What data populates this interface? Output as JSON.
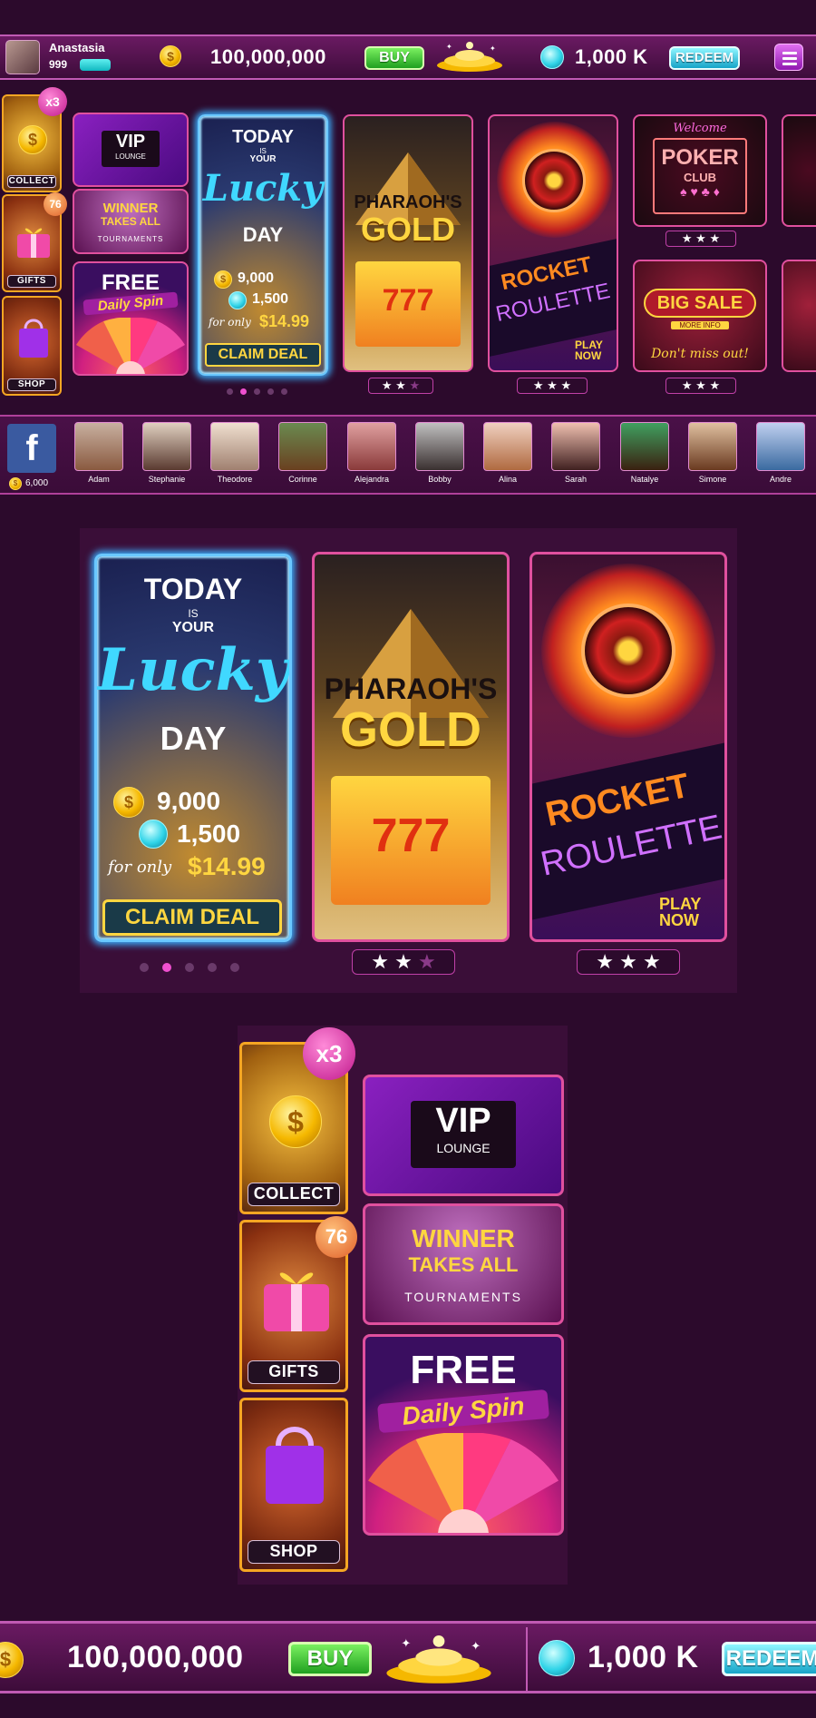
{
  "topbar": {
    "username": "Anastasia",
    "level": "999",
    "coins": "100,000,000",
    "buy_label": "BUY",
    "gems": "1,000 K",
    "redeem_label": "REDEEM"
  },
  "side_tiles": {
    "collect": {
      "label": "COLLECT",
      "badge": "x3"
    },
    "gifts": {
      "label": "GIFTS",
      "badge": "76"
    },
    "shop": {
      "label": "SHOP"
    }
  },
  "promo_tiles": {
    "vip": {
      "line1": "VIP",
      "line2": "LOUNGE"
    },
    "winner": {
      "line1": "WINNER",
      "line2": "TAKES ALL",
      "line3": "TOURNAMENTS"
    },
    "free_spin": {
      "line1": "FREE",
      "line2": "Daily Spin"
    }
  },
  "lucky_deal": {
    "line1": "TODAY",
    "line2": "IS",
    "line3": "YOUR",
    "line4": "Lucky",
    "line5": "DAY",
    "coins": "9,000",
    "gems": "1,500",
    "price_prefix": "for only",
    "price": "$14.99",
    "button": "CLAIM DEAL"
  },
  "games": [
    {
      "name1": "PHARAOH'S",
      "name2": "GOLD",
      "sub": "777",
      "stars": 2
    },
    {
      "name1": "ROCKET",
      "name2": "ROULETTE",
      "play": "PLAY NOW",
      "stars": 3
    },
    {
      "welcome": "Welcome",
      "name1": "POKER",
      "name2": "CLUB",
      "stars": 3
    },
    {
      "name1": "BIG SALE",
      "sub": "MORE INFO",
      "tag": "Don't miss out!",
      "stars": 3
    }
  ],
  "friends": {
    "facebook_bonus": "6,000",
    "list": [
      "Adam",
      "Stephanie",
      "Theodore",
      "Corinne",
      "Alejandra",
      "Bobby",
      "Alina",
      "Sarah",
      "Natalye",
      "Simone",
      "Andre"
    ]
  },
  "colors": {
    "background": "#2c0a2c",
    "accent_pink": "#e0509e",
    "gold": "#f5c518",
    "cyan": "#30d4e8",
    "green": "#20a020"
  }
}
